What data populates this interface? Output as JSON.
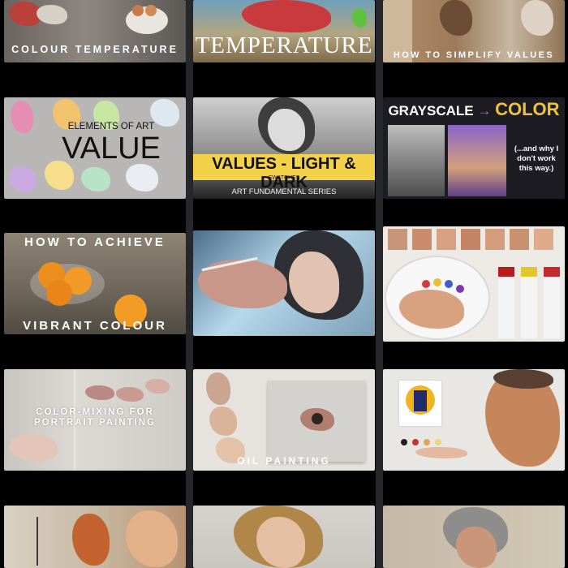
{
  "grid": {
    "tiles": [
      {
        "caption": "COLOUR TEMPERATURE"
      },
      {
        "caption": "TEMPERATURE"
      },
      {
        "caption": "HOW TO SIMPLIFY VALUES"
      },
      {
        "line1": "ELEMENTS OF ART",
        "line2": "VALUE"
      },
      {
        "line1": "VALUES - LIGHT & DARK",
        "line2": "SWATCHES",
        "line3": "ART FUNDAMENTAL SERIES"
      },
      {
        "left": "GRAYSCALE",
        "arrow": "→",
        "right": "COLOR",
        "note": "(...and why I don't work this way.)"
      },
      {
        "line1": "HOW TO ACHIEVE",
        "line2": "VIBRANT COLOUR"
      },
      {
        "caption": ""
      },
      {
        "caption": ""
      },
      {
        "line1": "COLOR-MIXING FOR",
        "line2": "PORTRAIT PAINTING"
      },
      {
        "caption": "OIL PAINTING"
      },
      {
        "caption": ""
      },
      {
        "caption": ""
      },
      {
        "caption": ""
      },
      {
        "caption": ""
      }
    ]
  }
}
